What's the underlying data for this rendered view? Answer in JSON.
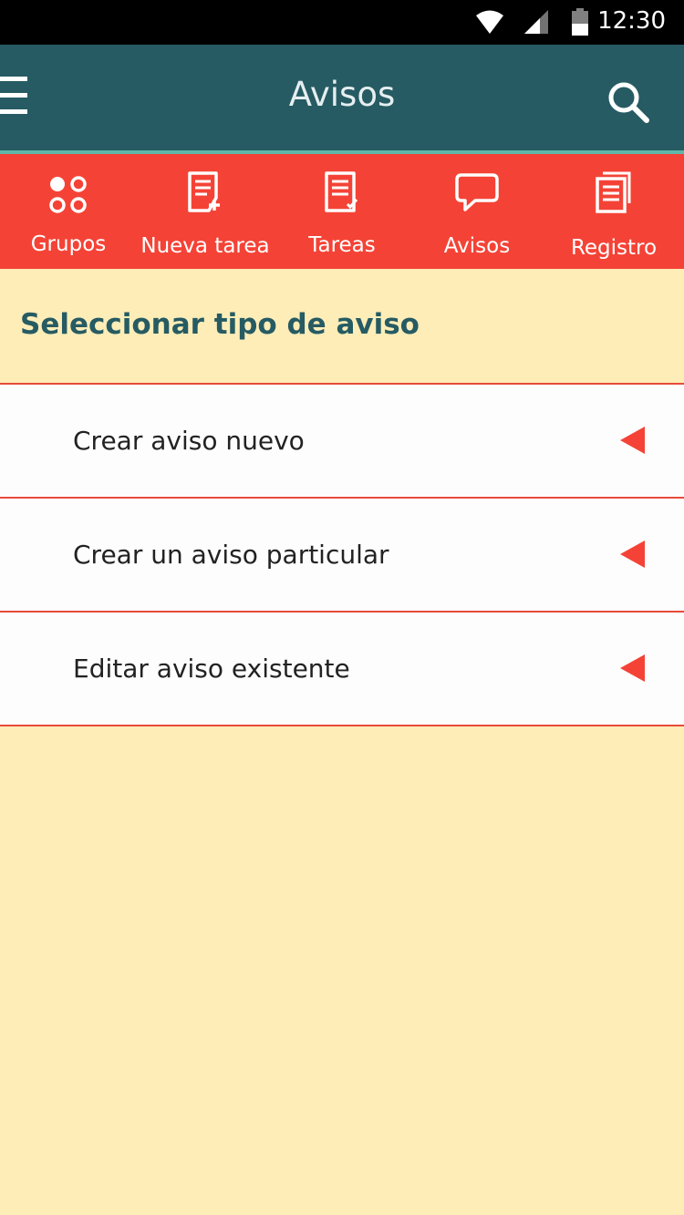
{
  "status_bar": {
    "time": "12:30",
    "icons": [
      "wifi-icon",
      "signal-icon",
      "battery-icon"
    ]
  },
  "app_bar": {
    "title": "Avisos",
    "left_icon": "menu-icon",
    "right_icon": "search-icon"
  },
  "tabs": [
    {
      "label": "Grupos",
      "icon": "groups-icon"
    },
    {
      "label": "Nueva tarea",
      "icon": "new-task-icon"
    },
    {
      "label": "Tareas",
      "icon": "tasks-icon"
    },
    {
      "label": "Avisos",
      "icon": "notice-bubble-icon"
    },
    {
      "label": "Registro",
      "icon": "register-icon"
    }
  ],
  "section": {
    "title": "Seleccionar tipo de aviso"
  },
  "list": {
    "items": [
      {
        "label": "Crear aviso nuevo",
        "icon": "arrow-left-icon"
      },
      {
        "label": "Crear un aviso particular",
        "icon": "arrow-left-icon"
      },
      {
        "label": "Editar aviso existente",
        "icon": "arrow-left-icon"
      }
    ]
  },
  "colors": {
    "status_bar": "#000000",
    "app_bar": "#265B63",
    "app_bar_accent": "#5FB7A8",
    "tab_bar": "#F44336",
    "background": "#FFEDB8",
    "list_item": "#FDFDFE",
    "divider": "#E84B3A",
    "section_title": "#265B63"
  }
}
